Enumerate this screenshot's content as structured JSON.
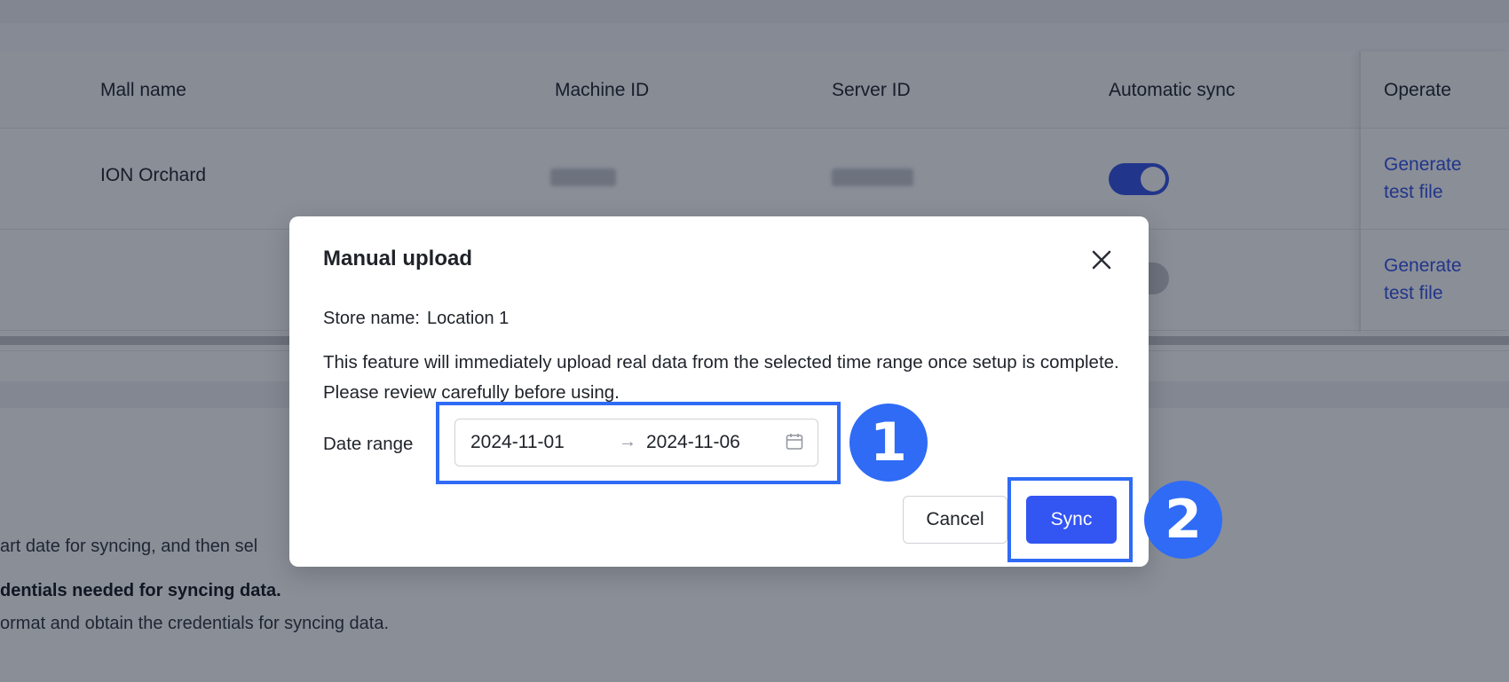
{
  "table": {
    "headers": {
      "mall_name": "Mall name",
      "machine_id": "Machine ID",
      "server_id": "Server ID",
      "automatic_sync": "Automatic sync",
      "operate": "Operate"
    },
    "rows": [
      {
        "mall_name": "ION Orchard",
        "automatic_sync": true,
        "action": "Generate test file"
      },
      {
        "mall_name": "",
        "automatic_sync": false,
        "action": "Generate test file"
      }
    ]
  },
  "background_text": {
    "line1": "art date for syncing, and then sel",
    "line2": "dentials needed for syncing data.",
    "line3": "ormat and obtain the credentials for syncing data."
  },
  "modal": {
    "title": "Manual upload",
    "store_label": "Store name:",
    "store_value": "Location 1",
    "description": "This feature will immediately upload real data from the selected time range once setup is complete. Please review carefully before using.",
    "date_range_label": "Date range",
    "start_date": "2024-11-01",
    "end_date": "2024-11-06",
    "arrow": "→",
    "cancel_label": "Cancel",
    "sync_label": "Sync"
  },
  "annotations": {
    "step1": "1",
    "step2": "2"
  },
  "colors": {
    "accent": "#3355f2",
    "annotation": "#2f6bf5",
    "link": "#3d5ce8"
  }
}
